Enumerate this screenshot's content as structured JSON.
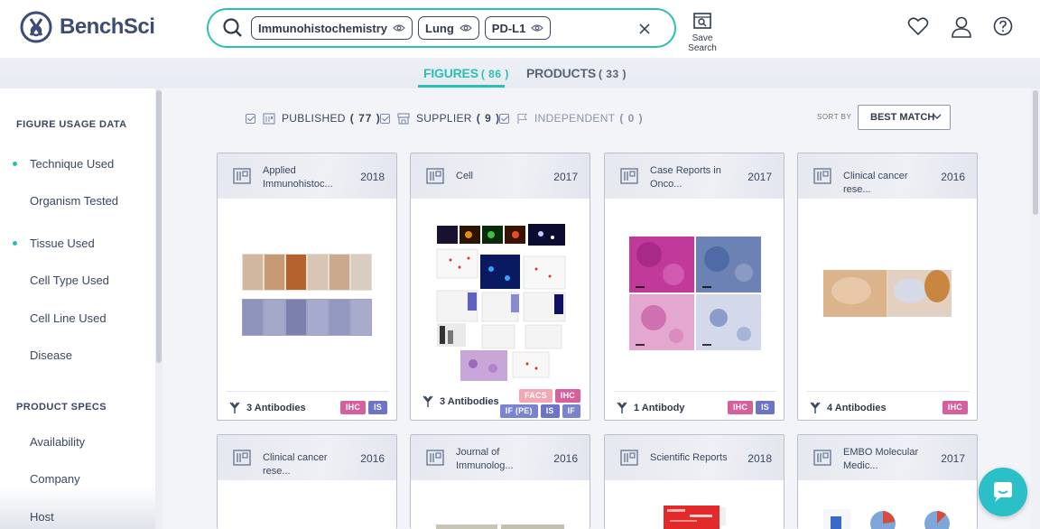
{
  "brand": {
    "name": "BenchSci"
  },
  "search": {
    "chips": [
      "Immunohistochemistry",
      "Lung",
      "PD-L1"
    ],
    "save_label": "Save Search"
  },
  "tabs": [
    {
      "label": "FIGURES",
      "count": "( 86 )"
    },
    {
      "label": "PRODUCTS",
      "count": "( 33 )"
    }
  ],
  "sidebar": {
    "usage_heading": "FIGURE USAGE DATA",
    "usage_items": [
      "Technique Used",
      "Organism Tested",
      "Tissue Used",
      "Cell Type Used",
      "Cell Line Used",
      "Disease"
    ],
    "specs_heading": "PRODUCT SPECS",
    "specs_items": [
      "Availability",
      "Company",
      "Host"
    ]
  },
  "filters": [
    {
      "label": "PUBLISHED",
      "count": "( 77 )"
    },
    {
      "label": "SUPPLIER",
      "count": "( 9 )"
    },
    {
      "label": "INDEPENDENT",
      "count": "( 0 )"
    }
  ],
  "sort": {
    "label": "SORT BY",
    "value": "BEST MATCH"
  },
  "cards": [
    {
      "journal": "Applied Immunohistoc...",
      "year": "2018",
      "antibodies": "3 Antibodies",
      "tags": [
        "IHC",
        "IS"
      ]
    },
    {
      "journal": "Cell",
      "year": "2017",
      "antibodies": "3 Antibodies",
      "tags_row1": [
        "FACS",
        "IHC"
      ],
      "tags_row2": [
        "IF (PE)",
        "IS",
        "IF"
      ]
    },
    {
      "journal": "Case Reports in Onco...",
      "year": "2017",
      "antibodies": "1 Antibody",
      "tags": [
        "IHC",
        "IS"
      ]
    },
    {
      "journal": "Clinical cancer rese...",
      "year": "2016",
      "antibodies": "4 Antibodies",
      "tags": [
        "IHC"
      ]
    },
    {
      "journal": "Clinical cancer rese...",
      "year": "2016"
    },
    {
      "journal": "Journal of Immunolog...",
      "year": "2016"
    },
    {
      "journal": "Scientific Reports",
      "year": "2018"
    },
    {
      "journal": "EMBO Molecular Medic...",
      "year": "2017"
    }
  ],
  "colors": {
    "accent": "#2bbfb3",
    "ihc": "#d6609c",
    "is": "#6b74c9",
    "facs": "#f2a7b5"
  }
}
